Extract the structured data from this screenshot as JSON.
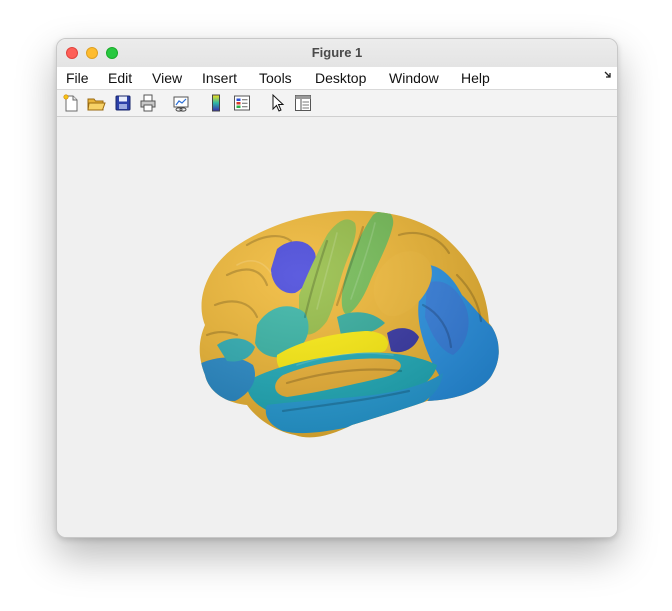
{
  "window": {
    "title": "Figure 1"
  },
  "menu": {
    "items": [
      "File",
      "Edit",
      "View",
      "Insert",
      "Tools",
      "Desktop",
      "Window",
      "Help"
    ]
  },
  "toolbar": {
    "tools": [
      "new-figure-icon",
      "open-file-icon",
      "save-icon",
      "print-icon",
      "link-plot-icon",
      "colorbar-icon",
      "legend-icon",
      "edit-plot-arrow-icon",
      "property-inspector-icon"
    ]
  },
  "figure": {
    "content": "brain-surface-render",
    "region_colors": [
      "#f0b428",
      "#3a3ad8",
      "#8fba3a",
      "#6ab84a",
      "#2ab0a0",
      "#ffee00",
      "#1e8fe6",
      "#12a9b8",
      "#2a2aa0"
    ]
  }
}
